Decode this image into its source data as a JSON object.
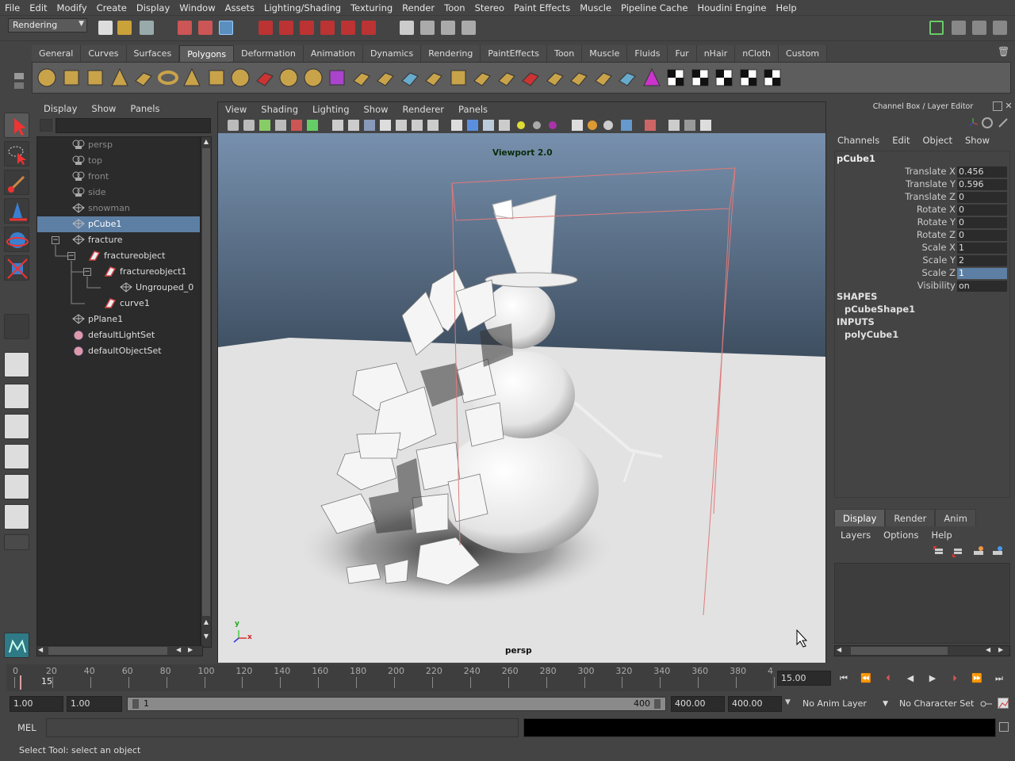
{
  "menubar": [
    "File",
    "Edit",
    "Modify",
    "Create",
    "Display",
    "Window",
    "Assets",
    "Lighting/Shading",
    "Texturing",
    "Render",
    "Toon",
    "Stereo",
    "Paint Effects",
    "Muscle",
    "Pipeline Cache",
    "Houdini Engine",
    "Help"
  ],
  "status_line": {
    "mode": "Rendering"
  },
  "shelf": {
    "tabs": [
      "General",
      "Curves",
      "Surfaces",
      "Polygons",
      "Deformation",
      "Animation",
      "Dynamics",
      "Rendering",
      "PaintEffects",
      "Toon",
      "Muscle",
      "Fluids",
      "Fur",
      "nHair",
      "nCloth",
      "Custom"
    ],
    "active_tab": "Polygons"
  },
  "outliner": {
    "menus": [
      "Display",
      "Show",
      "Panels"
    ],
    "items": [
      {
        "label": "persp",
        "icon": "camera-icon",
        "dim": true,
        "level": 0
      },
      {
        "label": "top",
        "icon": "camera-icon",
        "dim": true,
        "level": 0
      },
      {
        "label": "front",
        "icon": "camera-icon",
        "dim": true,
        "level": 0
      },
      {
        "label": "side",
        "icon": "camera-icon",
        "dim": true,
        "level": 0
      },
      {
        "label": "snowman",
        "icon": "mesh-icon",
        "dim": true,
        "level": 0
      },
      {
        "label": "pCube1",
        "icon": "mesh-icon",
        "selected": true,
        "level": 0
      },
      {
        "label": "fracture",
        "icon": "group-icon",
        "level": 0,
        "expander": "−"
      },
      {
        "label": "fractureobject",
        "icon": "fracture-icon",
        "level": 1,
        "expander": "−"
      },
      {
        "label": "fractureobject1",
        "icon": "fracture-icon",
        "level": 2,
        "expander": "−"
      },
      {
        "label": "Ungrouped_0",
        "icon": "mesh-icon",
        "level": 3
      },
      {
        "label": "curve1",
        "icon": "fracture-icon",
        "level": 2
      },
      {
        "label": "pPlane1",
        "icon": "mesh-icon",
        "level": 0
      },
      {
        "label": "defaultLightSet",
        "icon": "set-icon",
        "level": 0
      },
      {
        "label": "defaultObjectSet",
        "icon": "set-icon",
        "level": 0
      }
    ]
  },
  "viewport": {
    "menus": [
      "View",
      "Shading",
      "Lighting",
      "Show",
      "Renderer",
      "Panels"
    ],
    "renderer_label": "Viewport 2.0",
    "camera_label": "persp",
    "axis_y": "y",
    "axis_x": "x"
  },
  "channel_box": {
    "header": "Channel Box / Layer Editor",
    "menus": [
      "Channels",
      "Edit",
      "Object",
      "Show"
    ],
    "object": "pCube1",
    "attributes": [
      {
        "name": "Translate X",
        "value": "0.456"
      },
      {
        "name": "Translate Y",
        "value": "0.596"
      },
      {
        "name": "Translate Z",
        "value": "0"
      },
      {
        "name": "Rotate X",
        "value": "0"
      },
      {
        "name": "Rotate Y",
        "value": "0"
      },
      {
        "name": "Rotate Z",
        "value": "0"
      },
      {
        "name": "Scale X",
        "value": "1"
      },
      {
        "name": "Scale Y",
        "value": "2"
      },
      {
        "name": "Scale Z",
        "value": "1",
        "highlighted": true
      },
      {
        "name": "Visibility",
        "value": "on"
      }
    ],
    "shapes_label": "SHAPES",
    "shape": "pCubeShape1",
    "inputs_label": "INPUTS",
    "input": "polyCube1"
  },
  "layer_editor": {
    "tabs": [
      "Display",
      "Render",
      "Anim"
    ],
    "active_tab": "Display",
    "menus": [
      "Layers",
      "Options",
      "Help"
    ]
  },
  "time_slider": {
    "ticks": [
      "0",
      "20",
      "40",
      "60",
      "80",
      "100",
      "120",
      "140",
      "160",
      "180",
      "200",
      "220",
      "240",
      "260",
      "280",
      "300",
      "320",
      "340",
      "360",
      "380",
      "4"
    ],
    "current_frame_marker": "15",
    "current_frame": "15.00"
  },
  "range_slider": {
    "start": "1.00",
    "anim_start": "1.00",
    "range_min_label": "1",
    "range_max_label": "400",
    "anim_end": "400.00",
    "end": "400.00",
    "anim_layer": "No Anim Layer",
    "character_set": "No Character Set"
  },
  "command_line": {
    "label": "MEL"
  },
  "help_line": {
    "text": "Select Tool: select an object"
  }
}
